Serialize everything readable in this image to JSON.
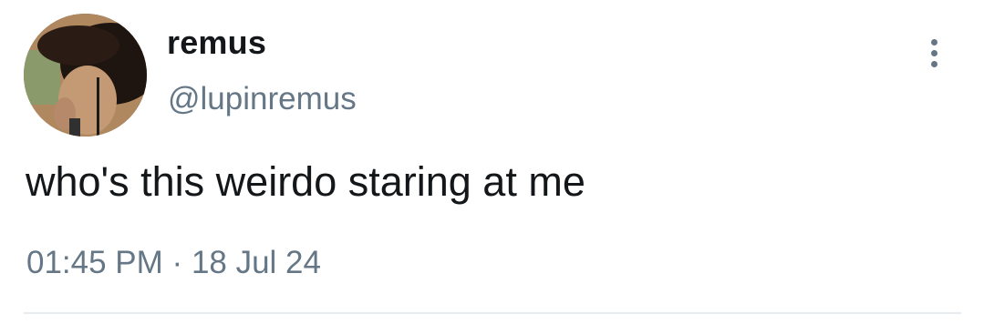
{
  "tweet": {
    "display_name": "remus",
    "handle": "@lupinremus",
    "text": "who's this weirdo staring at me",
    "time": "01:45 PM",
    "separator": "·",
    "date": "18 Jul 24"
  },
  "icons": {
    "avatar": "profile-photo",
    "more": "vertical-ellipsis-icon"
  },
  "colors": {
    "primary_text": "#14171a",
    "secondary_text": "#657786",
    "divider": "#e6ecf0"
  }
}
